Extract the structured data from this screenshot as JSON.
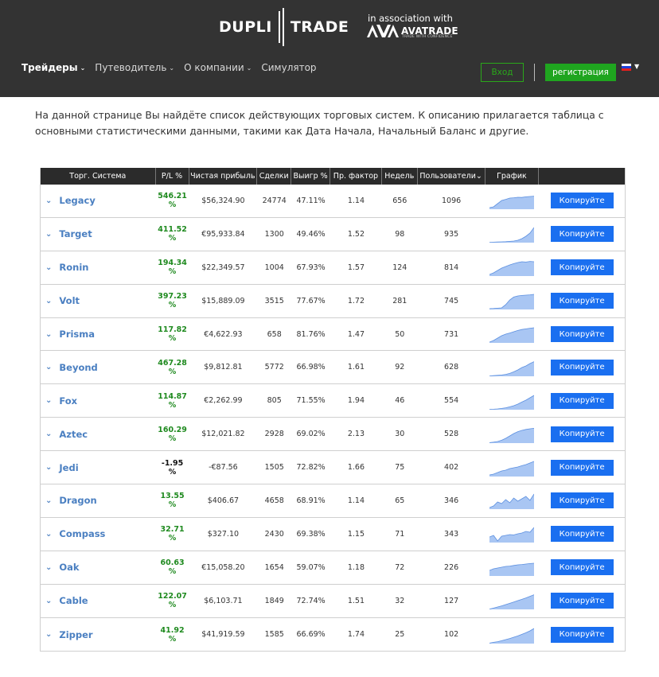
{
  "header": {
    "logo_left": "DUPLI",
    "logo_right": "TRADE",
    "association": "in association with",
    "partner": "AVATRADE",
    "partner_sub": "TRADE WITH CONFIDENCE"
  },
  "nav": {
    "items": [
      {
        "label": "Трейдеры",
        "active": true,
        "has_dropdown": true
      },
      {
        "label": "Путеводитель",
        "active": false,
        "has_dropdown": true
      },
      {
        "label": "О компании",
        "active": false,
        "has_dropdown": true
      },
      {
        "label": "Симулятор",
        "active": false,
        "has_dropdown": false
      }
    ],
    "login": "Вход",
    "register": "регистрация",
    "language_flag": "ru-flag"
  },
  "intro": "На данной странице Вы найдёте список действующих торговых систем. К описанию прилагается таблица с основными статистическими данными, такими как Дата Начала, Начальный Баланс и другие.",
  "table": {
    "headers": [
      "Торг. Система",
      "P/L %",
      "Чистая прибыль",
      "Сделки",
      "Выигр %",
      "Пр. фактор",
      "Недель",
      "Пользователи",
      "График",
      ""
    ],
    "copy_label": "Копируйте",
    "rows": [
      {
        "name": "Legacy",
        "pl": "546.21\n%",
        "profit": "$56,324.90",
        "trades": "24774",
        "win": "47.11%",
        "pf": "1.14",
        "weeks": "656",
        "users": "1096",
        "trend": [
          0.1,
          0.15,
          0.35,
          0.55,
          0.62,
          0.7,
          0.72,
          0.75,
          0.74,
          0.78,
          0.8,
          0.82
        ]
      },
      {
        "name": "Target",
        "pl": "411.52\n%",
        "profit": "€95,933.84",
        "trades": "1300",
        "win": "49.46%",
        "pf": "1.52",
        "weeks": "98",
        "users": "935",
        "trend": [
          0.02,
          0.03,
          0.04,
          0.05,
          0.06,
          0.08,
          0.1,
          0.15,
          0.25,
          0.4,
          0.6,
          0.95
        ]
      },
      {
        "name": "Ronin",
        "pl": "194.34\n%",
        "profit": "$22,349.57",
        "trades": "1004",
        "win": "67.93%",
        "pf": "1.57",
        "weeks": "124",
        "users": "814",
        "trend": [
          0.1,
          0.2,
          0.35,
          0.5,
          0.6,
          0.7,
          0.78,
          0.85,
          0.9,
          0.88,
          0.92,
          0.9
        ]
      },
      {
        "name": "Volt",
        "pl": "397.23\n%",
        "profit": "$15,889.09",
        "trades": "3515",
        "win": "77.67%",
        "pf": "1.72",
        "weeks": "281",
        "users": "745",
        "trend": [
          0.05,
          0.06,
          0.08,
          0.1,
          0.3,
          0.6,
          0.78,
          0.85,
          0.88,
          0.9,
          0.92,
          0.95
        ]
      },
      {
        "name": "Prisma",
        "pl": "117.82\n%",
        "profit": "€4,622.93",
        "trades": "658",
        "win": "81.76%",
        "pf": "1.47",
        "weeks": "50",
        "users": "731",
        "trend": [
          0.05,
          0.15,
          0.3,
          0.45,
          0.55,
          0.62,
          0.7,
          0.78,
          0.84,
          0.88,
          0.92,
          0.95
        ]
      },
      {
        "name": "Beyond",
        "pl": "467.28\n%",
        "profit": "$9,812.81",
        "trades": "5772",
        "win": "66.98%",
        "pf": "1.61",
        "weeks": "92",
        "users": "628",
        "trend": [
          0.02,
          0.04,
          0.06,
          0.08,
          0.12,
          0.18,
          0.28,
          0.4,
          0.55,
          0.65,
          0.8,
          0.92
        ]
      },
      {
        "name": "Fox",
        "pl": "114.87\n%",
        "profit": "€2,262.99",
        "trades": "805",
        "win": "71.55%",
        "pf": "1.94",
        "weeks": "46",
        "users": "554",
        "trend": [
          0.02,
          0.03,
          0.05,
          0.08,
          0.12,
          0.18,
          0.25,
          0.35,
          0.48,
          0.6,
          0.75,
          0.9
        ]
      },
      {
        "name": "Aztec",
        "pl": "160.29\n%",
        "profit": "$12,021.82",
        "trades": "2928",
        "win": "69.02%",
        "pf": "2.13",
        "weeks": "30",
        "users": "528",
        "trend": [
          0.03,
          0.06,
          0.1,
          0.18,
          0.3,
          0.45,
          0.6,
          0.72,
          0.8,
          0.86,
          0.9,
          0.93
        ]
      },
      {
        "name": "Jedi",
        "pl": "-1.95\n%",
        "profit": "-€87.56",
        "trades": "1505",
        "win": "72.82%",
        "pf": "1.66",
        "weeks": "75",
        "users": "402",
        "neg": true,
        "trend": [
          0.1,
          0.15,
          0.25,
          0.35,
          0.4,
          0.5,
          0.55,
          0.6,
          0.68,
          0.75,
          0.85,
          0.95
        ]
      },
      {
        "name": "Dragon",
        "pl": "13.55\n%",
        "profit": "$406.67",
        "trades": "4658",
        "win": "68.91%",
        "pf": "1.14",
        "weeks": "65",
        "users": "346",
        "trend": [
          0.1,
          0.2,
          0.45,
          0.35,
          0.6,
          0.4,
          0.7,
          0.5,
          0.65,
          0.8,
          0.55,
          0.95
        ]
      },
      {
        "name": "Compass",
        "pl": "32.71\n%",
        "profit": "$327.10",
        "trades": "2430",
        "win": "69.38%",
        "pf": "1.15",
        "weeks": "71",
        "users": "343",
        "trend": [
          0.35,
          0.45,
          0.1,
          0.4,
          0.45,
          0.5,
          0.48,
          0.55,
          0.6,
          0.7,
          0.65,
          0.95
        ]
      },
      {
        "name": "Oak",
        "pl": "60.63\n%",
        "profit": "€15,058.20",
        "trades": "1654",
        "win": "59.07%",
        "pf": "1.18",
        "weeks": "72",
        "users": "226",
        "trend": [
          0.35,
          0.45,
          0.5,
          0.55,
          0.6,
          0.62,
          0.66,
          0.7,
          0.72,
          0.75,
          0.78,
          0.8
        ]
      },
      {
        "name": "Cable",
        "pl": "122.07\n%",
        "profit": "$6,103.71",
        "trades": "1849",
        "win": "72.74%",
        "pf": "1.51",
        "weeks": "32",
        "users": "127",
        "trend": [
          0.02,
          0.08,
          0.15,
          0.22,
          0.3,
          0.38,
          0.46,
          0.55,
          0.63,
          0.72,
          0.82,
          0.92
        ]
      },
      {
        "name": "Zipper",
        "pl": "41.92\n%",
        "profit": "$41,919.59",
        "trades": "1585",
        "win": "66.69%",
        "pf": "1.74",
        "weeks": "25",
        "users": "102",
        "trend": [
          0.03,
          0.08,
          0.12,
          0.18,
          0.25,
          0.32,
          0.4,
          0.48,
          0.58,
          0.68,
          0.8,
          0.95
        ]
      }
    ]
  },
  "colors": {
    "header_bg": "#333333",
    "accent_green": "#1fa51f",
    "link_blue": "#4a7fc1",
    "button_blue": "#1a6ff0",
    "chart_fill": "#a9c6f3",
    "chart_line": "#5b8fe0"
  }
}
